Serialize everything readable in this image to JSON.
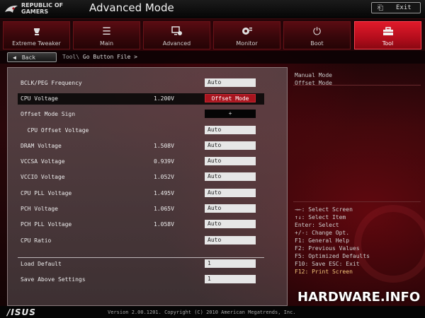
{
  "header": {
    "brand_line1": "REPUBLIC OF",
    "brand_line2": "GAMERS",
    "mode_title": "Advanced Mode",
    "exit_label": "Exit"
  },
  "tabs": [
    {
      "label": "Extreme Tweaker",
      "icon": "gauge-icon"
    },
    {
      "label": "Main",
      "icon": "list-icon"
    },
    {
      "label": "Advanced",
      "icon": "monitor-gear-icon"
    },
    {
      "label": "Monitor",
      "icon": "fan-gear-icon"
    },
    {
      "label": "Boot",
      "icon": "power-icon"
    },
    {
      "label": "Tool",
      "icon": "toolbox-icon",
      "active": true
    }
  ],
  "breadcrumb": {
    "back_label": "Back",
    "parent": "Tool\\",
    "current": "Go Button File >"
  },
  "settings": [
    {
      "label": "BCLK/PEG Frequency",
      "current": "",
      "value": "Auto"
    },
    {
      "label": "CPU Voltage",
      "current": "1.200V",
      "value": "Offset Mode",
      "selected": true
    },
    {
      "label": "Offset Mode Sign",
      "current": "",
      "value": "+"
    },
    {
      "label": "  CPU Offset Voltage",
      "current": "",
      "value": "Auto"
    },
    {
      "label": "DRAM Voltage",
      "current": "1.508V",
      "value": "Auto"
    },
    {
      "label": "VCCSA Voltage",
      "current": "0.939V",
      "value": "Auto"
    },
    {
      "label": "VCCIO Voltage",
      "current": "1.052V",
      "value": "Auto"
    },
    {
      "label": "CPU PLL Voltage",
      "current": "1.495V",
      "value": "Auto"
    },
    {
      "label": "PCH Voltage",
      "current": "1.065V",
      "value": "Auto"
    },
    {
      "label": "PCH PLL Voltage",
      "current": "1.058V",
      "value": "Auto"
    },
    {
      "label": "CPU Ratio",
      "current": "",
      "value": "Auto"
    },
    {
      "label": "Load Default",
      "current": "",
      "value": "1"
    },
    {
      "label": "Save Above Settings",
      "current": "",
      "value": "1"
    }
  ],
  "help": {
    "options": [
      "Manual Mode",
      "Offset Mode"
    ],
    "keys": [
      "→←: Select Screen",
      "↑↓: Select Item",
      "Enter: Select",
      "+/-: Change Opt.",
      "F1: General Help",
      "F2: Previous Values",
      "F5: Optimized Defaults",
      "F10: Save  ESC: Exit",
      "F12: Print Screen"
    ]
  },
  "footer": {
    "logo": "/ISUS",
    "version": "Version 2.00.1201. Copyright (C) 2010 American Megatrends, Inc."
  },
  "watermark": {
    "text": "HARDWARE.INFO"
  },
  "colors": {
    "accent": "#d01525",
    "highlight": "#a8141e",
    "panel": "#6e6264"
  }
}
